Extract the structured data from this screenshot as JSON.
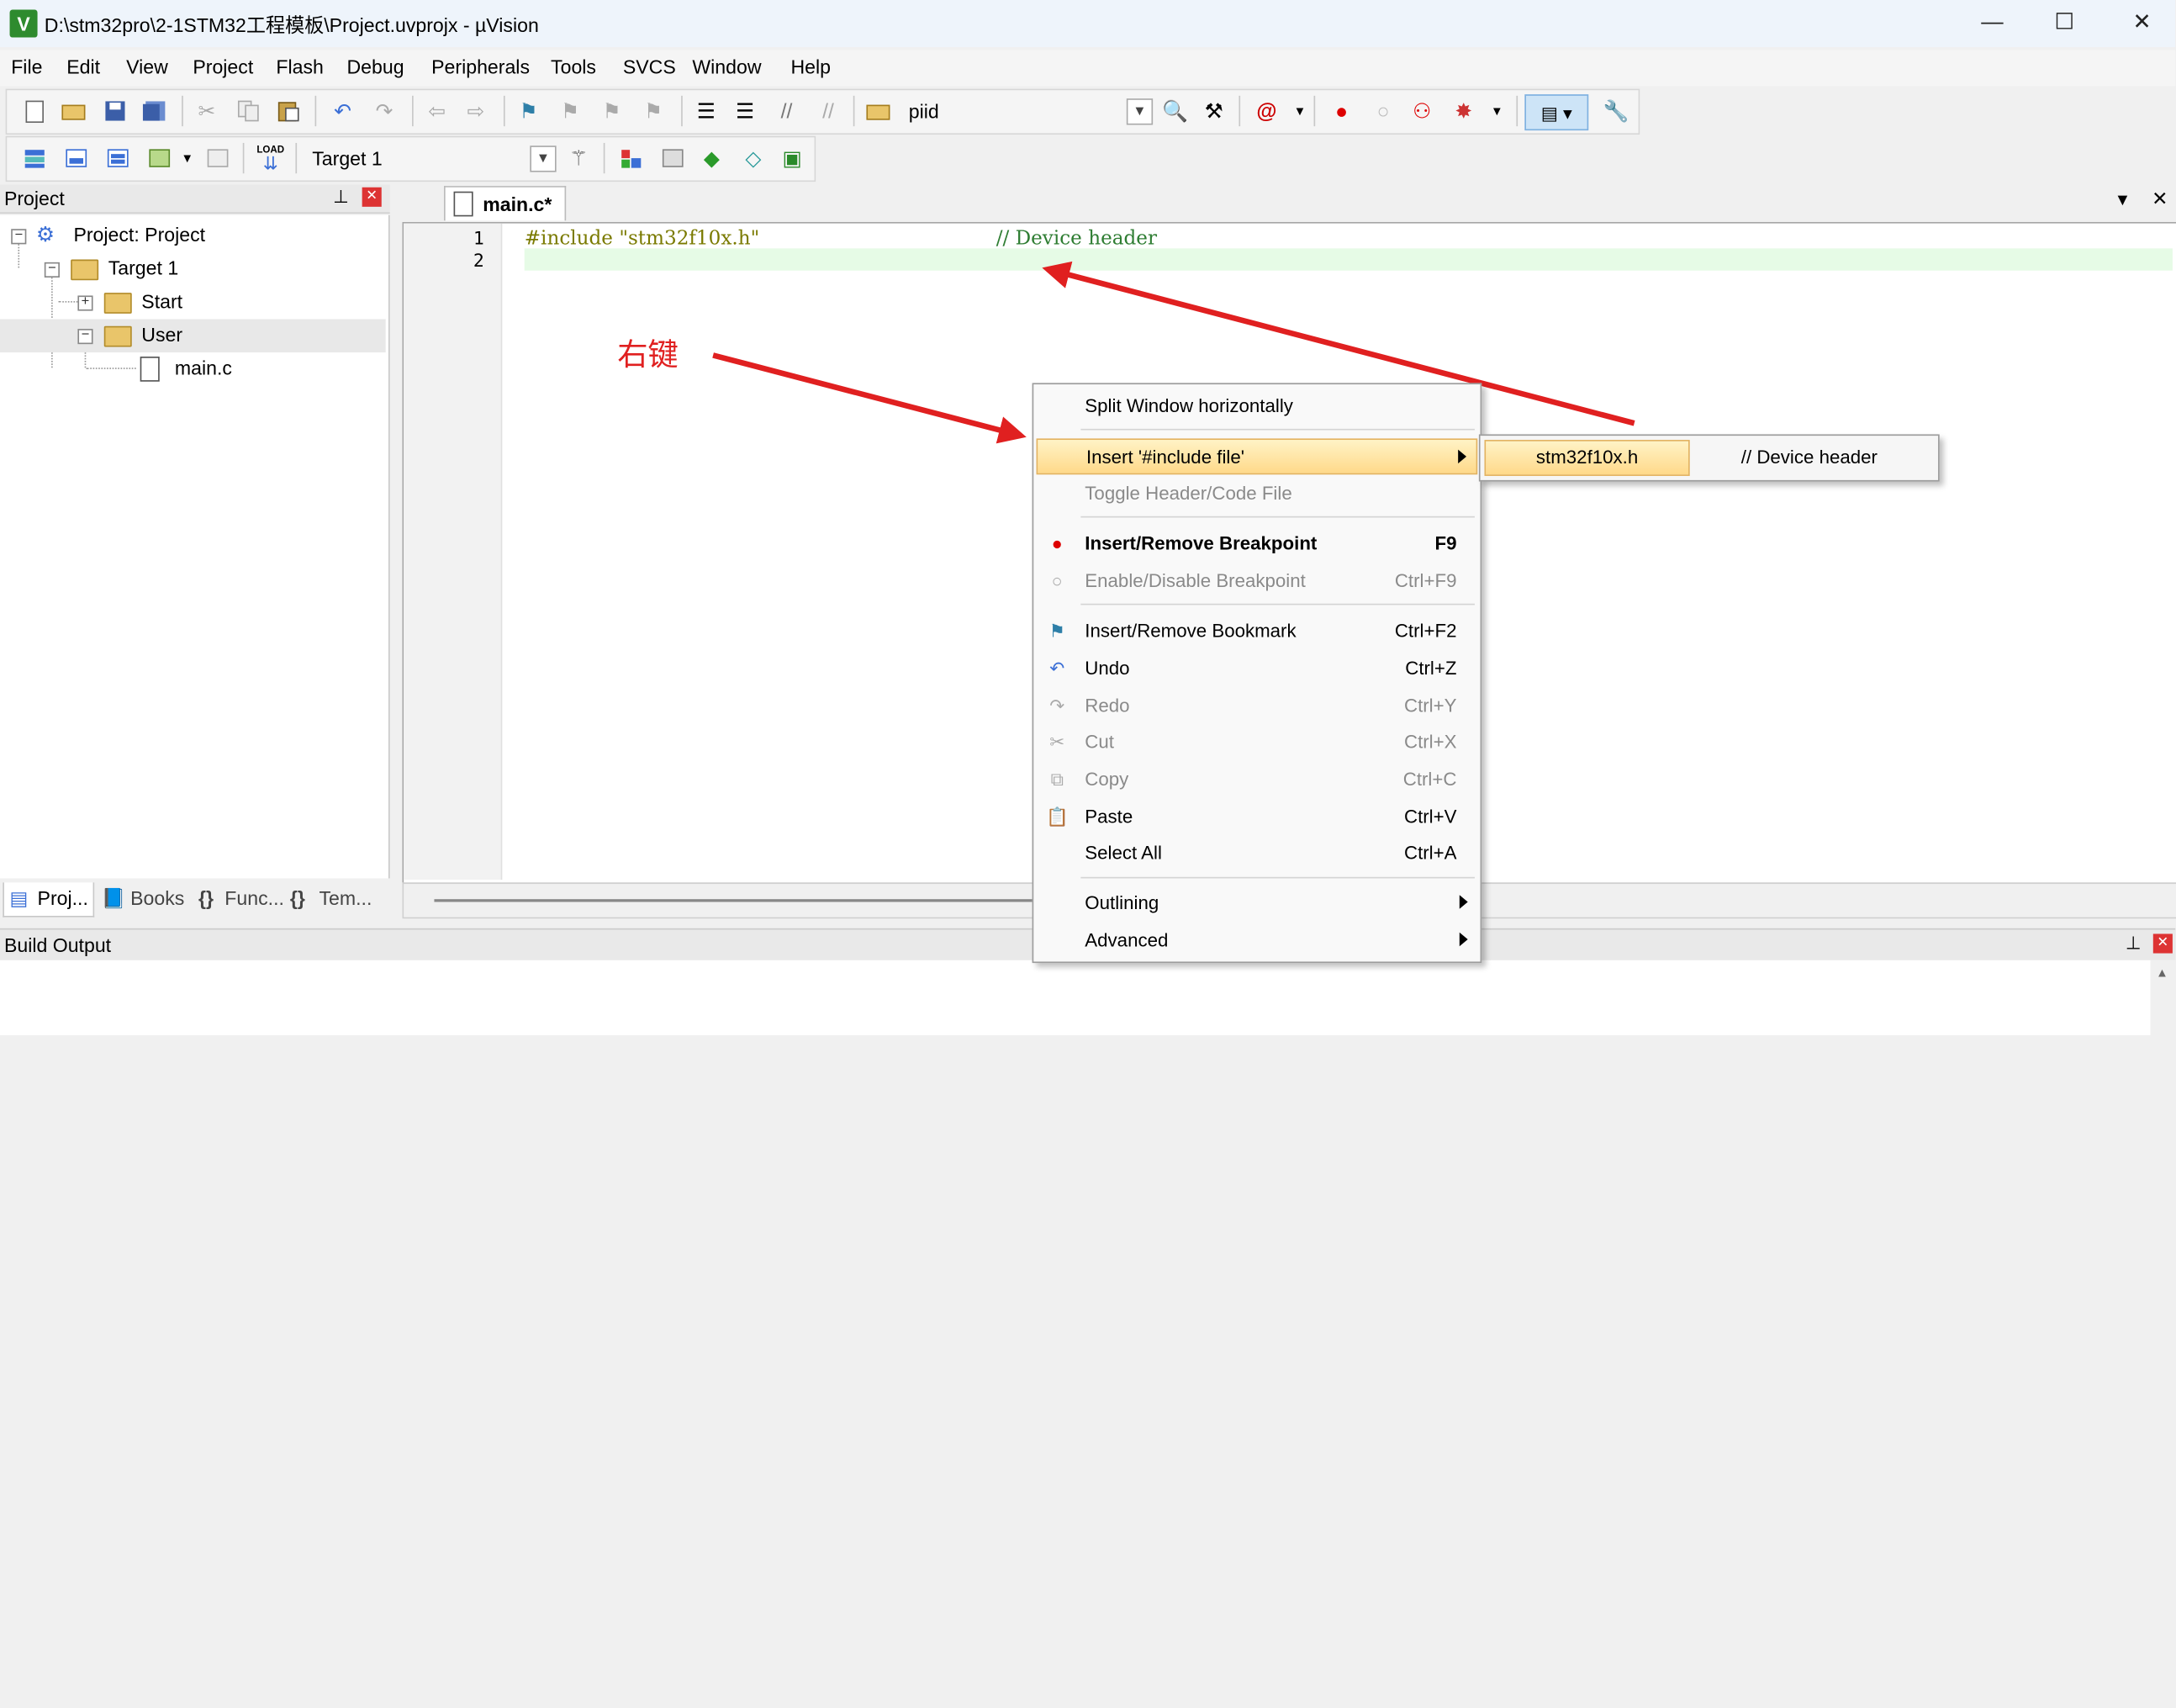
{
  "window": {
    "title": "D:\\stm32pro\\2-1STM32工程模板\\Project.uvprojx - µVision",
    "min_glyph": "—",
    "max_glyph": "☐",
    "close_glyph": "✕"
  },
  "menubar": [
    "File",
    "Edit",
    "View",
    "Project",
    "Flash",
    "Debug",
    "Peripherals",
    "Tools",
    "SVCS",
    "Window",
    "Help"
  ],
  "toolbar1": {
    "find_combo_value": "piid"
  },
  "toolbar2": {
    "target_combo_value": "Target 1",
    "load_label": "LOAD"
  },
  "project_panel": {
    "title": "Project",
    "tree": {
      "root": "Project: Project",
      "target": "Target 1",
      "group_start": "Start",
      "group_user": "User",
      "file": "main.c"
    },
    "tabs": [
      "Proj...",
      "Books",
      "Func...",
      "Tem..."
    ]
  },
  "editor": {
    "tab_label": "main.c*",
    "lines": [
      {
        "num": "1",
        "include": "#include \"stm32f10x.h\"",
        "comment": "// Device header"
      },
      {
        "num": "2",
        "include": "",
        "comment": ""
      }
    ]
  },
  "build_output": {
    "title": "Build Output"
  },
  "annotation": {
    "text": "右键"
  },
  "context_menu": {
    "items": [
      {
        "label": "Split Window horizontally",
        "shortcut": "",
        "state": "normal"
      },
      {
        "label": "Insert '#include file'",
        "shortcut": "",
        "state": "highlighted",
        "submenu": true
      },
      {
        "label": "Toggle Header/Code File",
        "shortcut": "",
        "state": "disabled"
      },
      {
        "label": "Insert/Remove Breakpoint",
        "shortcut": "F9",
        "state": "bold"
      },
      {
        "label": "Enable/Disable Breakpoint",
        "shortcut": "Ctrl+F9",
        "state": "disabled"
      },
      {
        "label": "Insert/Remove Bookmark",
        "shortcut": "Ctrl+F2",
        "state": "normal"
      },
      {
        "label": "Undo",
        "shortcut": "Ctrl+Z",
        "state": "normal"
      },
      {
        "label": "Redo",
        "shortcut": "Ctrl+Y",
        "state": "disabled"
      },
      {
        "label": "Cut",
        "shortcut": "Ctrl+X",
        "state": "disabled"
      },
      {
        "label": "Copy",
        "shortcut": "Ctrl+C",
        "state": "disabled"
      },
      {
        "label": "Paste",
        "shortcut": "Ctrl+V",
        "state": "normal"
      },
      {
        "label": "Select All",
        "shortcut": "Ctrl+A",
        "state": "normal"
      },
      {
        "label": "Outlining",
        "shortcut": "",
        "state": "normal",
        "submenu": true
      },
      {
        "label": "Advanced",
        "shortcut": "",
        "state": "normal",
        "submenu": true
      }
    ]
  },
  "submenu": {
    "item": "stm32f10x.h",
    "comment": "// Device header"
  },
  "colors": {
    "include_text": "#7a7a00",
    "comment_text": "#2e7d32",
    "current_line": "#e6fbe6",
    "annotation_red": "#e02020",
    "menu_highlight": "#ffd98a"
  }
}
